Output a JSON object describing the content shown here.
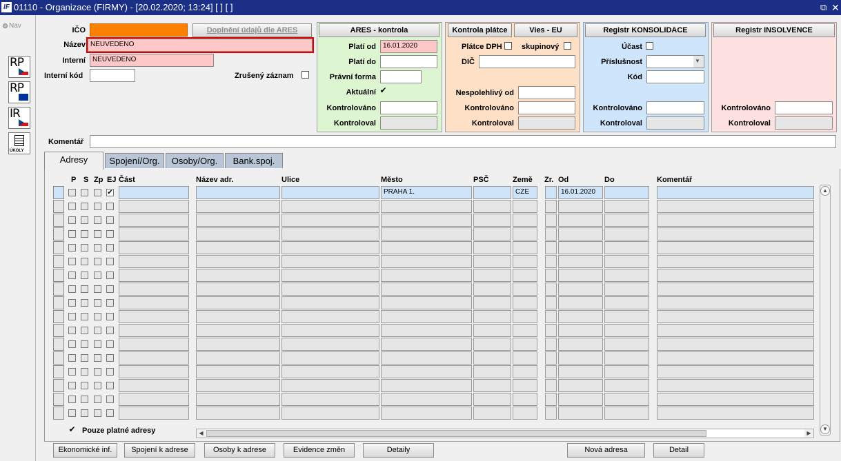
{
  "window": {
    "title": "01110 - Organizace (FIRMY) - [20.02.2020; 13:24]  [ ]  [ ]",
    "app_icon": "IF",
    "restore_icon": "restore-icon",
    "close_icon": "close-icon"
  },
  "leftbar": {
    "nav_label": "Nav",
    "buttons": [
      {
        "text": "RP",
        "flag": "cz"
      },
      {
        "text": "RP",
        "flag": "eu"
      },
      {
        "text": "IR",
        "flag": "cz"
      },
      {
        "text": "ÚKOLY",
        "flag": "none"
      }
    ]
  },
  "form": {
    "ico_label": "IČO",
    "ico_value": "",
    "ares_fill_button": "Doplnění údajů dle ARES",
    "nazev_label": "Název",
    "nazev_value": "NEUVEDENO",
    "interni_label": "Interní",
    "interni_value": "NEUVEDENO",
    "interni_kod_label": "Interní kód",
    "interni_kod_value": "",
    "zruseny_label": "Zrušený záznam",
    "zruseny_checked": false,
    "komentar_label": "Komentář",
    "komentar_value": ""
  },
  "ares": {
    "button": "ARES - kontrola",
    "plati_od_label": "Platí od",
    "plati_od_value": "16.01.2020",
    "plati_do_label": "Platí do",
    "plati_do_value": "",
    "pravni_forma_label": "Právní forma",
    "pravni_forma_value": "",
    "aktualni_label": "Aktuální",
    "aktualni_checked": true,
    "kontrolovano_label": "Kontrolováno",
    "kontrolovano_value": "",
    "kontroloval_label": "Kontroloval",
    "kontroloval_value": ""
  },
  "dph": {
    "kontrola_button": "Kontrola plátce",
    "vies_button": "Vies - EU",
    "platce_label": "Plátce DPH",
    "platce_checked": false,
    "skupinovy_label": "skupinový",
    "skupinovy_checked": false,
    "dic_label": "DIČ",
    "dic_value": "",
    "nespolehlivy_label": "Nespolehlivý od",
    "nespolehlivy_value": "",
    "kontrolovano_label": "Kontrolováno",
    "kontrolovano_value": "",
    "kontroloval_label": "Kontroloval",
    "kontroloval_value": ""
  },
  "konsolidace": {
    "button": "Registr KONSOLIDACE",
    "ucast_label": "Účast",
    "ucast_checked": false,
    "prislusnost_label": "Příslušnost",
    "prislusnost_value": "",
    "kod_label": "Kód",
    "kod_value": "",
    "kontrolovano_label": "Kontrolováno",
    "kontrolovano_value": "",
    "kontroloval_label": "Kontroloval",
    "kontroloval_value": ""
  },
  "insolvence": {
    "button": "Registr INSOLVENCE",
    "kontrolovano_label": "Kontrolováno",
    "kontrolovano_value": "",
    "kontroloval_label": "Kontroloval",
    "kontroloval_value": ""
  },
  "tabs": [
    "Adresy",
    "Spojení/Org.",
    "Osoby/Org.",
    "Bank.spoj."
  ],
  "active_tab": 0,
  "grid": {
    "columns": [
      "P",
      "S",
      "Zp",
      "EJ",
      "Část",
      "Název adr.",
      "Ulice",
      "Město",
      "PSČ",
      "Země",
      "Zr.",
      "Od",
      "Do",
      "Komentář"
    ],
    "rows": [
      {
        "P": false,
        "S": false,
        "Zp": false,
        "EJ": true,
        "cast": "",
        "nazev": "",
        "ulice": "",
        "mesto": "PRAHA 1.",
        "psc": "",
        "zeme": "CZE",
        "zr": "",
        "od": "16.01.2020",
        "do": "",
        "komentar": ""
      }
    ],
    "empty_rows": 16
  },
  "pouze_platne_label": "Pouze platné adresy",
  "pouze_platne_checked": true,
  "bottom_buttons": [
    "Ekonomické inf.",
    "Spojení k adrese",
    "Osoby k adrese",
    "Evidence změn",
    "Detaily",
    "Nová adresa",
    "Detail"
  ],
  "colors": {
    "titlebar": "#1b2f86",
    "ico_field": "#ff8000",
    "required_field": "#ffc8c8",
    "ares_panel": "#ddf5d0",
    "dph_panel": "#fde0c6",
    "konsolidace_panel": "#cfe5fb",
    "insolvence_panel": "#fde0e0",
    "current_row": "#cfe4f8"
  }
}
